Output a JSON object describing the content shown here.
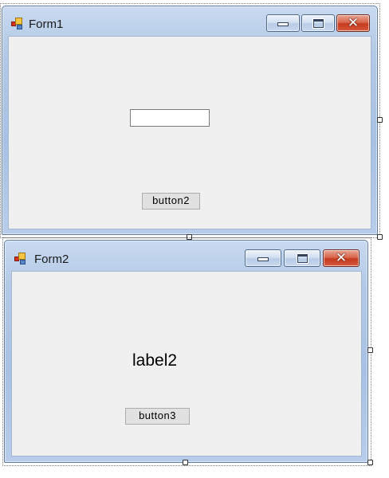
{
  "form1": {
    "title": "Form1",
    "textbox_value": "",
    "button_label": "button2"
  },
  "form2": {
    "title": "Form2",
    "label_text": "label2",
    "button_label": "button3"
  },
  "icons": {
    "app": "windows-form-app-icon",
    "minimize": "minimize-icon",
    "maximize": "maximize-icon",
    "close": "close-icon"
  },
  "colors": {
    "client_background": "#f0f0f0",
    "titlebar_blue": "#b3c9e6",
    "close_red": "#c63a1e"
  }
}
